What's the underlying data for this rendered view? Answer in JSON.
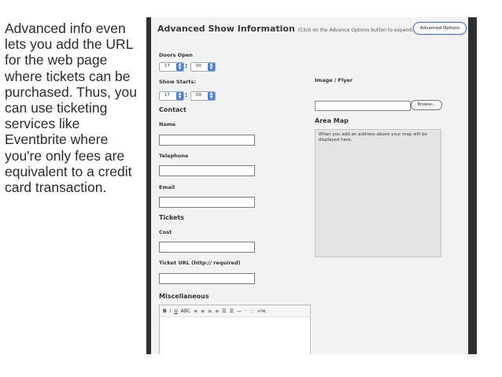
{
  "caption": "Advanced info even lets you add the URL for the web page where tickets can be purchased. Thus, you can use ticketing services like Eventbrite where you're only fees are equivalent to a credit card transaction.",
  "form": {
    "title": "Advanced Show Information",
    "hint": "(Click on the Advance Options button to expand)",
    "advanced_button": "Advanced Options",
    "doors_open": {
      "label": "Doors Open",
      "hour": "17",
      "minute": "00"
    },
    "show_starts": {
      "label": "Show Starts:",
      "hour": "17",
      "minute": "00"
    },
    "colon": ":",
    "contact": {
      "heading": "Contact",
      "name_label": "Name",
      "telephone_label": "Telephone",
      "email_label": "Email"
    },
    "tickets": {
      "heading": "Tickets",
      "cost_label": "Cost",
      "url_label": "Ticket URL (http:// required)"
    },
    "miscellaneous": {
      "heading": "Miscellaneous"
    },
    "image": {
      "label": "Image / Flyer",
      "browse": "Browse..."
    },
    "area_map": {
      "heading": "Area Map",
      "message": "When you add an address above your map will be displayed here."
    },
    "toolbar": [
      "B",
      "I",
      "U",
      "ABC",
      "≡",
      "≡",
      "≡",
      "≡",
      "☰",
      "☰",
      "—",
      "⎯",
      "○",
      "HTML"
    ]
  }
}
